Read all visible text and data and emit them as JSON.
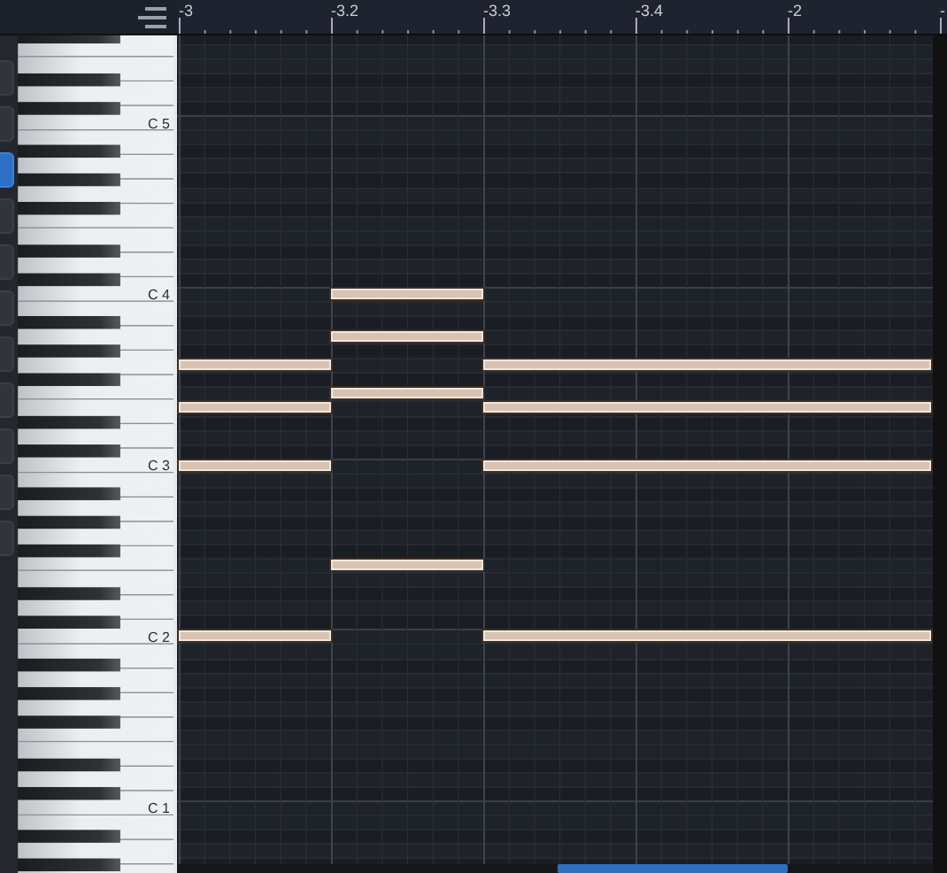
{
  "ruler": {
    "labels": [
      "-3",
      "-3.2",
      "-3.3",
      "-3.4",
      "-2",
      "-"
    ]
  },
  "keyboard": {
    "labels": [
      "C 5",
      "C 4",
      "C 3",
      "C 2",
      "C 1"
    ]
  },
  "side_buttons": [
    {
      "selected": false
    },
    {
      "selected": false
    },
    {
      "selected": true
    },
    {
      "selected": false
    },
    {
      "selected": false
    },
    {
      "selected": false
    },
    {
      "selected": false
    },
    {
      "selected": false
    },
    {
      "selected": false
    },
    {
      "selected": false
    },
    {
      "selected": false
    }
  ],
  "note_rows": [
    {
      "notes": [
        false,
        false,
        false
      ]
    },
    {
      "notes": [
        false,
        false,
        false
      ]
    },
    {
      "notes": [
        false,
        false,
        false
      ]
    },
    {
      "notes": [
        false,
        false,
        false
      ]
    },
    {
      "notes": [
        false,
        false,
        false
      ]
    },
    {
      "notes": [
        false,
        false,
        false
      ]
    },
    {
      "notes": [
        false,
        false,
        false
      ]
    },
    {
      "notes": [
        false,
        false,
        false
      ]
    },
    {
      "notes": [
        false,
        false,
        false
      ]
    },
    {
      "notes": [
        false,
        false,
        false
      ]
    },
    {
      "notes": [
        false,
        false,
        false
      ]
    },
    {
      "notes": [
        false,
        false,
        false
      ]
    },
    {
      "notes": [
        false,
        false,
        false
      ]
    },
    {
      "notes": [
        false,
        false,
        false
      ]
    },
    {
      "notes": [
        false,
        false,
        false
      ]
    },
    {
      "notes": [
        false,
        false,
        false
      ]
    },
    {
      "notes": [
        false,
        false,
        false
      ]
    },
    {
      "notes": [
        false,
        false,
        false
      ]
    },
    {
      "notes": [
        false,
        true,
        false
      ]
    },
    {
      "notes": [
        false,
        false,
        false
      ]
    },
    {
      "notes": [
        false,
        false,
        false
      ]
    },
    {
      "notes": [
        false,
        true,
        false
      ]
    },
    {
      "notes": [
        false,
        false,
        false
      ]
    },
    {
      "notes": [
        true,
        false,
        true
      ]
    },
    {
      "notes": [
        false,
        false,
        false
      ]
    },
    {
      "notes": [
        false,
        true,
        false
      ]
    },
    {
      "notes": [
        true,
        false,
        true
      ]
    },
    {
      "notes": [
        false,
        false,
        false
      ]
    },
    {
      "notes": [
        false,
        false,
        false
      ]
    },
    {
      "notes": [
        false,
        false,
        false
      ]
    },
    {
      "notes": [
        true,
        false,
        true
      ]
    },
    {
      "notes": [
        false,
        false,
        false
      ]
    },
    {
      "notes": [
        false,
        false,
        false
      ]
    },
    {
      "notes": [
        false,
        false,
        false
      ]
    },
    {
      "notes": [
        false,
        false,
        false
      ]
    },
    {
      "notes": [
        false,
        false,
        false
      ]
    },
    {
      "notes": [
        false,
        false,
        false
      ]
    },
    {
      "notes": [
        false,
        true,
        false
      ]
    },
    {
      "notes": [
        false,
        false,
        false
      ]
    },
    {
      "notes": [
        false,
        false,
        false
      ]
    },
    {
      "notes": [
        false,
        false,
        false
      ]
    },
    {
      "notes": [
        false,
        false,
        false
      ]
    },
    {
      "notes": [
        true,
        false,
        true
      ]
    },
    {
      "notes": [
        false,
        false,
        false
      ]
    },
    {
      "notes": [
        false,
        false,
        false
      ]
    },
    {
      "notes": [
        false,
        false,
        false
      ]
    },
    {
      "notes": [
        false,
        false,
        false
      ]
    },
    {
      "notes": [
        false,
        false,
        false
      ]
    },
    {
      "notes": [
        false,
        false,
        false
      ]
    },
    {
      "notes": [
        false,
        false,
        false
      ]
    },
    {
      "notes": [
        false,
        false,
        false
      ]
    },
    {
      "notes": [
        false,
        false,
        false
      ]
    },
    {
      "notes": [
        false,
        false,
        false
      ]
    },
    {
      "notes": [
        false,
        false,
        false
      ]
    },
    {
      "notes": [
        false,
        false,
        false
      ]
    },
    {
      "notes": [
        false,
        false,
        false
      ]
    },
    {
      "notes": [
        false,
        false,
        false
      ]
    },
    {
      "notes": [
        false,
        false,
        false
      ]
    },
    {
      "notes": [
        false,
        false,
        false
      ]
    }
  ]
}
